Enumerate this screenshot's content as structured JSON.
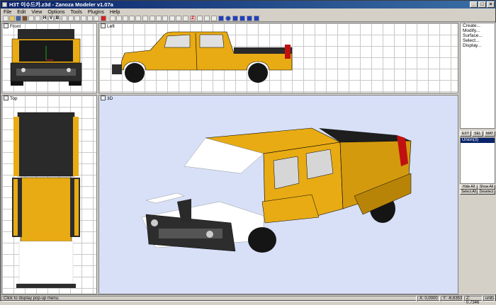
{
  "window": {
    "title": "H3T 이수드카.z3d - Zanoza Modeler v1.07a",
    "btn_min": "_",
    "btn_max": "□",
    "btn_close": "×"
  },
  "menu": [
    "File",
    "Edit",
    "View",
    "Options",
    "Tools",
    "Plugins",
    "Help"
  ],
  "toolbar": {
    "h_label": "H",
    "v_label": "V",
    "b_label": "B",
    "z_label": "Z"
  },
  "viewports": {
    "front": "Front",
    "left": "Left",
    "top": "Top",
    "persp": "3D"
  },
  "panel": {
    "commands": [
      "Create...",
      "Modify...",
      "Surface...",
      "Select...",
      "Display..."
    ],
    "tabs": [
      "EXT",
      "SEL",
      "MAT"
    ],
    "objects": [
      "Union(3)"
    ],
    "hide_all": "Hide All",
    "show_all": "Show All",
    "select_all": "Select All",
    "deselect": "Deselect"
  },
  "status": {
    "message": "Click to display pop-up menu.",
    "x_value": "X: 0,0000",
    "y_value": "Y: -6,6353",
    "z_value": "Z: 0,7346",
    "units": "units"
  },
  "colors": {
    "body": "#e8ab14",
    "body_dark": "#b88408",
    "roof": "#2a2a2a",
    "grid": "#c9c9c9",
    "persp_bg": "#d7e0f7"
  }
}
